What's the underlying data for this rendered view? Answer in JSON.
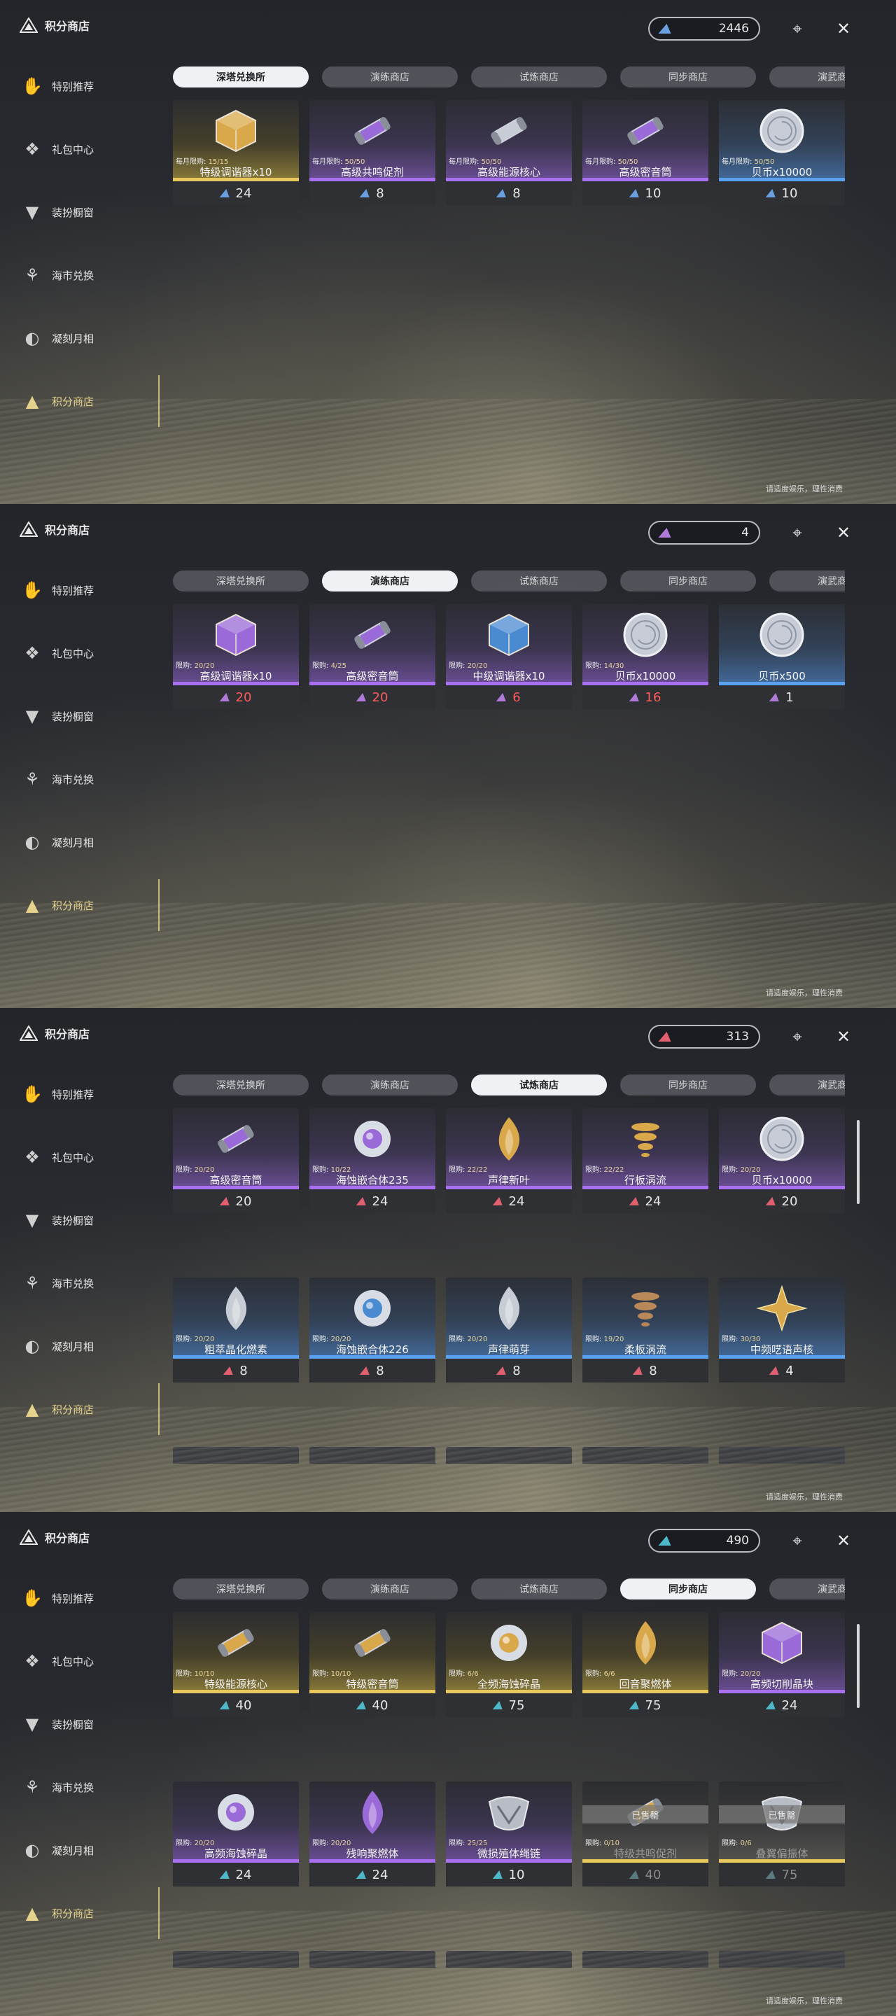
{
  "sidebar": {
    "title": "积分商店",
    "items": [
      {
        "label": "特别推荐",
        "icon": "thumbs-up-icon"
      },
      {
        "label": "礼包中心",
        "icon": "gift-icon"
      },
      {
        "label": "装扮橱窗",
        "icon": "shirt-icon"
      },
      {
        "label": "海市兑换",
        "icon": "coral-icon"
      },
      {
        "label": "凝刻月相",
        "icon": "moon-icon"
      },
      {
        "label": "积分商店",
        "icon": "triangle-shop-icon",
        "active": true
      }
    ]
  },
  "tabs": [
    "深塔兑换所",
    "演练商店",
    "试炼商店",
    "同步商店",
    "演武商店"
  ],
  "limit_monthly_label": "每月限购:",
  "limit_label": "限购:",
  "sold_out_label": "已售罄",
  "footer_note": "请适度娱乐，理性消费",
  "colors": {
    "gold": "#e8c85a",
    "purple": "#a86ff0",
    "blue": "#5aa0f0"
  },
  "panels": [
    {
      "active_tab": 0,
      "currency_amount": "2446",
      "currency_color": "#6aa0e0",
      "items": [
        {
          "name": "特级调谐器x10",
          "limit": "15/15",
          "monthly": true,
          "rarity": "gold",
          "price": "24",
          "art": "polyhedron-gold"
        },
        {
          "name": "高级共鸣促剂",
          "limit": "50/50",
          "monthly": true,
          "rarity": "purple",
          "price": "8",
          "art": "vial-purple"
        },
        {
          "name": "高级能源核心",
          "limit": "50/50",
          "monthly": true,
          "rarity": "purple",
          "price": "8",
          "art": "capsule-yellow"
        },
        {
          "name": "高级密音筒",
          "limit": "50/50",
          "monthly": true,
          "rarity": "purple",
          "price": "10",
          "art": "capsule-purple"
        },
        {
          "name": "贝币x10000",
          "limit": "50/50",
          "monthly": true,
          "rarity": "blue",
          "price": "10",
          "art": "coin"
        }
      ]
    },
    {
      "active_tab": 1,
      "currency_amount": "4",
      "currency_color": "#b07ad8",
      "items": [
        {
          "name": "高级调谐器x10",
          "limit": "20/20",
          "rarity": "purple",
          "price": "20",
          "price_red": true,
          "art": "polyhedron-purple"
        },
        {
          "name": "高级密音筒",
          "limit": "4/25",
          "rarity": "purple",
          "price": "20",
          "price_red": true,
          "art": "capsule-purple"
        },
        {
          "name": "中级调谐器x10",
          "limit": "20/20",
          "rarity": "purple",
          "price": "6",
          "price_red": true,
          "art": "polyhedron-blue"
        },
        {
          "name": "贝币x10000",
          "limit": "14/30",
          "rarity": "purple",
          "price": "16",
          "price_red": true,
          "art": "coin"
        },
        {
          "name": "贝币x500",
          "limit": "",
          "rarity": "blue",
          "price": "1",
          "art": "coin"
        }
      ]
    },
    {
      "active_tab": 2,
      "currency_amount": "313",
      "currency_color": "#e06070",
      "items": [
        {
          "name": "高级密音筒",
          "limit": "20/20",
          "rarity": "purple",
          "price": "20",
          "art": "capsule-purple"
        },
        {
          "name": "海蚀嵌合体235",
          "limit": "10/22",
          "rarity": "purple",
          "price": "24",
          "art": "orb-purple"
        },
        {
          "name": "声律新叶",
          "limit": "22/22",
          "rarity": "purple",
          "price": "24",
          "art": "flame-gold"
        },
        {
          "name": "行板涡流",
          "limit": "22/22",
          "rarity": "purple",
          "price": "24",
          "art": "spiral-gold"
        },
        {
          "name": "贝币x10000",
          "limit": "20/20",
          "rarity": "purple",
          "price": "20",
          "art": "coin"
        },
        {
          "name": "粗萃晶化燃素",
          "limit": "20/20",
          "rarity": "blue",
          "price": "8",
          "art": "drop-silver"
        },
        {
          "name": "海蚀嵌合体226",
          "limit": "20/20",
          "rarity": "blue",
          "price": "8",
          "art": "orb-blue"
        },
        {
          "name": "声律萌芽",
          "limit": "20/20",
          "rarity": "blue",
          "price": "8",
          "art": "flame-dark"
        },
        {
          "name": "柔板涡流",
          "limit": "19/20",
          "rarity": "blue",
          "price": "8",
          "art": "spiral-bronze"
        },
        {
          "name": "中频呓语声核",
          "limit": "30/30",
          "rarity": "blue",
          "price": "4",
          "art": "star-gold"
        }
      ]
    },
    {
      "active_tab": 3,
      "currency_amount": "490",
      "currency_color": "#4fb8c8",
      "items": [
        {
          "name": "特级能源核心",
          "limit": "10/10",
          "rarity": "gold",
          "price": "40",
          "art": "capsule-orange"
        },
        {
          "name": "特级密音筒",
          "limit": "10/10",
          "rarity": "gold",
          "price": "40",
          "art": "capsule-gold"
        },
        {
          "name": "全频海蚀碎晶",
          "limit": "6/6",
          "rarity": "gold",
          "price": "75",
          "art": "disc-gold"
        },
        {
          "name": "回音聚燃体",
          "limit": "6/6",
          "rarity": "gold",
          "price": "75",
          "art": "feather-gold"
        },
        {
          "name": "高频切削晶块",
          "limit": "20/20",
          "rarity": "purple",
          "price": "24",
          "art": "cube-purple"
        },
        {
          "name": "高频海蚀碎晶",
          "limit": "20/20",
          "rarity": "purple",
          "price": "24",
          "art": "disc-purple"
        },
        {
          "name": "残响聚燃体",
          "limit": "20/20",
          "rarity": "purple",
          "price": "24",
          "art": "feather-purple"
        },
        {
          "name": "微损殖体绳链",
          "limit": "25/25",
          "rarity": "purple",
          "price": "10",
          "art": "chain-silver"
        },
        {
          "name": "特级共鸣促剂",
          "limit": "0/10",
          "rarity": "gold",
          "price": "40",
          "sold_out": true,
          "art": "vial-gold"
        },
        {
          "name": "叠翼偏振体",
          "limit": "0/6",
          "rarity": "gold",
          "price": "75",
          "sold_out": true,
          "art": "wing-silver"
        }
      ]
    }
  ]
}
